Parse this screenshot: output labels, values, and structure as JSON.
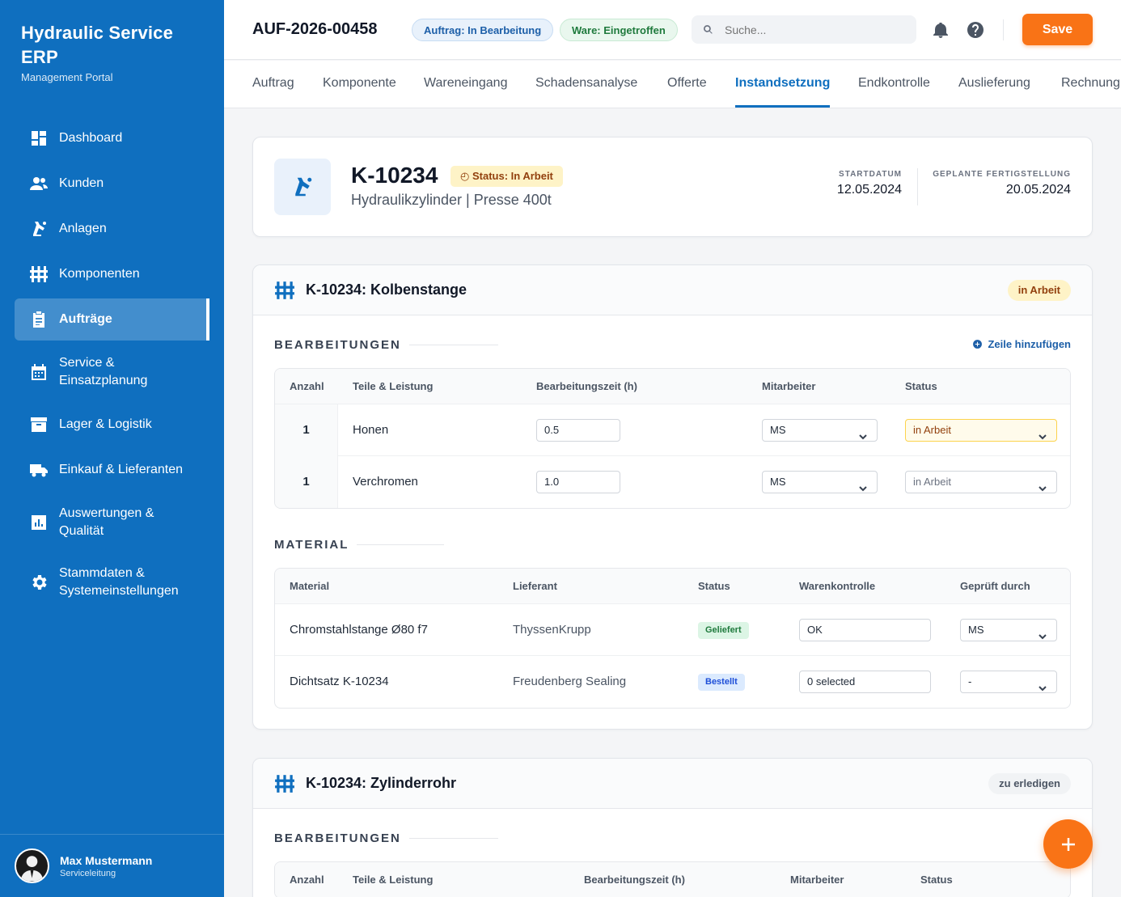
{
  "app": {
    "title": "Hydraulic Service ERP",
    "subtitle": "Management Portal"
  },
  "sidebar": {
    "items": [
      {
        "label": "Dashboard",
        "icon": "dashboard-icon"
      },
      {
        "label": "Kunden",
        "icon": "users-icon"
      },
      {
        "label": "Anlagen",
        "icon": "robot-arm-icon"
      },
      {
        "label": "Komponenten",
        "icon": "components-icon"
      },
      {
        "label": "Aufträge",
        "icon": "clipboard-icon",
        "active": true
      },
      {
        "label": "Service & Einsatzplanung",
        "icon": "calendar-icon"
      },
      {
        "label": "Lager & Logistik",
        "icon": "archive-icon"
      },
      {
        "label": "Einkauf & Lieferanten",
        "icon": "truck-icon"
      },
      {
        "label": "Auswertungen & Qualität",
        "icon": "chart-icon"
      },
      {
        "label": "Stammdaten & Systemeinstellungen",
        "icon": "gear-icon"
      }
    ],
    "user": {
      "name": "Max Mustermann",
      "role": "Serviceleitung"
    }
  },
  "header": {
    "order_id": "AUF-2026-00458",
    "order_status": "Auftrag: In Bearbeitung",
    "goods_status": "Ware: Eingetroffen",
    "search_placeholder": "Suche...",
    "save_label": "Save"
  },
  "tabs": [
    "Auftrag",
    "Komponente",
    "Wareneingang",
    "Schadensanalyse",
    "Offerte",
    "Instandsetzung",
    "Endkontrolle",
    "Auslieferung",
    "Rechnung"
  ],
  "active_tab": "Instandsetzung",
  "component": {
    "id": "K-10234",
    "status": "Status: In Arbeit",
    "description": "Hydraulikzylinder | Presse 400t",
    "start_label": "STARTDATUM",
    "start_date": "12.05.2024",
    "finish_label": "GEPLANTE FERTIGSTELLUNG",
    "finish_date": "20.05.2024"
  },
  "sections": [
    {
      "title": "K-10234: Kolbenstange",
      "badge": "in Arbeit",
      "work_heading": "BEARBEITUNGEN",
      "add_row_label": "Zeile hinzufügen",
      "work_columns": [
        "Anzahl",
        "Teile & Leistung",
        "Bearbeitungszeit (h)",
        "Mitarbeiter",
        "Status"
      ],
      "work_rows": [
        {
          "qty": "1",
          "task": "Honen",
          "hours": "0.5",
          "employee": "MS",
          "status": "in Arbeit"
        },
        {
          "qty": "1",
          "task": "Verchromen",
          "hours": "1.0",
          "employee": "MS",
          "status": "in Arbeit"
        }
      ],
      "material_heading": "MATERIAL",
      "material_columns": [
        "Material",
        "Lieferant",
        "Status",
        "Warenkontrolle",
        "Geprüft durch"
      ],
      "material_rows": [
        {
          "material": "Chromstahlstange Ø80 f7",
          "supplier": "ThyssenKrupp",
          "status": "Geliefert",
          "check": "OK",
          "checked_by": "MS"
        },
        {
          "material": "Dichtsatz K-10234",
          "supplier": "Freudenberg Sealing",
          "status": "Bestellt",
          "check": "0 selected",
          "checked_by": "-"
        }
      ]
    },
    {
      "title": "K-10234: Zylinderrohr",
      "badge": "zu erledigen",
      "work_heading": "BEARBEITUNGEN",
      "work_columns": [
        "Anzahl",
        "Teile & Leistung",
        "Bearbeitungszeit (h)",
        "Mitarbeiter",
        "Status"
      ]
    }
  ],
  "colors": {
    "primary": "#0f6fbf",
    "accent": "#f97316"
  }
}
